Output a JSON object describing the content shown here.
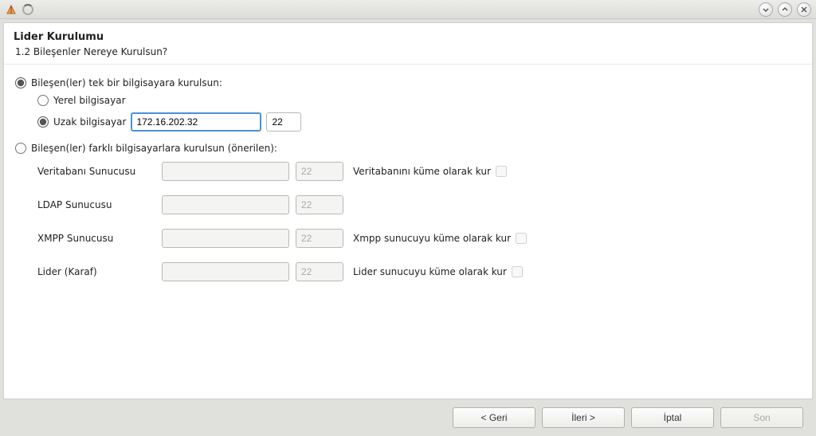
{
  "header": {
    "title": "Lider Kurulumu",
    "subtitle": "1.2 Bileşenler Nereye Kurulsun?"
  },
  "option1": {
    "label": "Bileşen(ler) tek bir bilgisayara kurulsun:",
    "local_label": "Yerel bilgisayar",
    "remote_label": "Uzak bilgisayar",
    "remote_ip": "172.16.202.32",
    "remote_port": "22"
  },
  "option2": {
    "label": "Bileşen(ler) farklı bilgisayarlara kurulsun (önerilen):",
    "rows": [
      {
        "label": "Veritabanı Sunucusu",
        "ip": "",
        "port": "22",
        "check_label": "Veritabanını küme olarak kur"
      },
      {
        "label": "LDAP Sunucusu",
        "ip": "",
        "port": "22",
        "check_label": ""
      },
      {
        "label": "XMPP Sunucusu",
        "ip": "",
        "port": "22",
        "check_label": "Xmpp sunucuyu küme olarak kur"
      },
      {
        "label": "Lider (Karaf)",
        "ip": "",
        "port": "22",
        "check_label": "Lider sunucuyu küme olarak kur"
      }
    ]
  },
  "footer": {
    "back": "< Geri",
    "next": "İleri >",
    "cancel": "İptal",
    "finish": "Son"
  }
}
